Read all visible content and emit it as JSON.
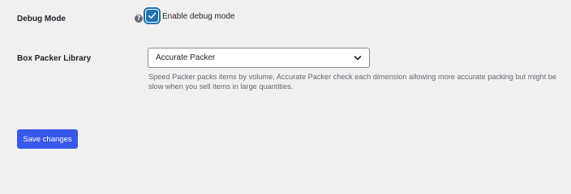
{
  "colors": {
    "background": "#f0f0f1",
    "accent": "#2271b1",
    "button": "#3858e9",
    "help_text": "#646970",
    "label_text": "#1d2327"
  },
  "debug_mode": {
    "label": "Debug Mode",
    "help_icon": "question-circle-icon",
    "help_glyph": "?",
    "checkbox_checked": true,
    "checkbox_label": "Enable debug mode"
  },
  "box_packer": {
    "label": "Box Packer Library",
    "selected_value": "Accurate Packer",
    "dropdown_icon": "chevron-down-icon",
    "description": "Speed Packer packs items by volume, Accurate Packer check each dimension allowing more accurate packing but might be slow when you sell items in large quantities."
  },
  "actions": {
    "save_label": "Save changes"
  }
}
